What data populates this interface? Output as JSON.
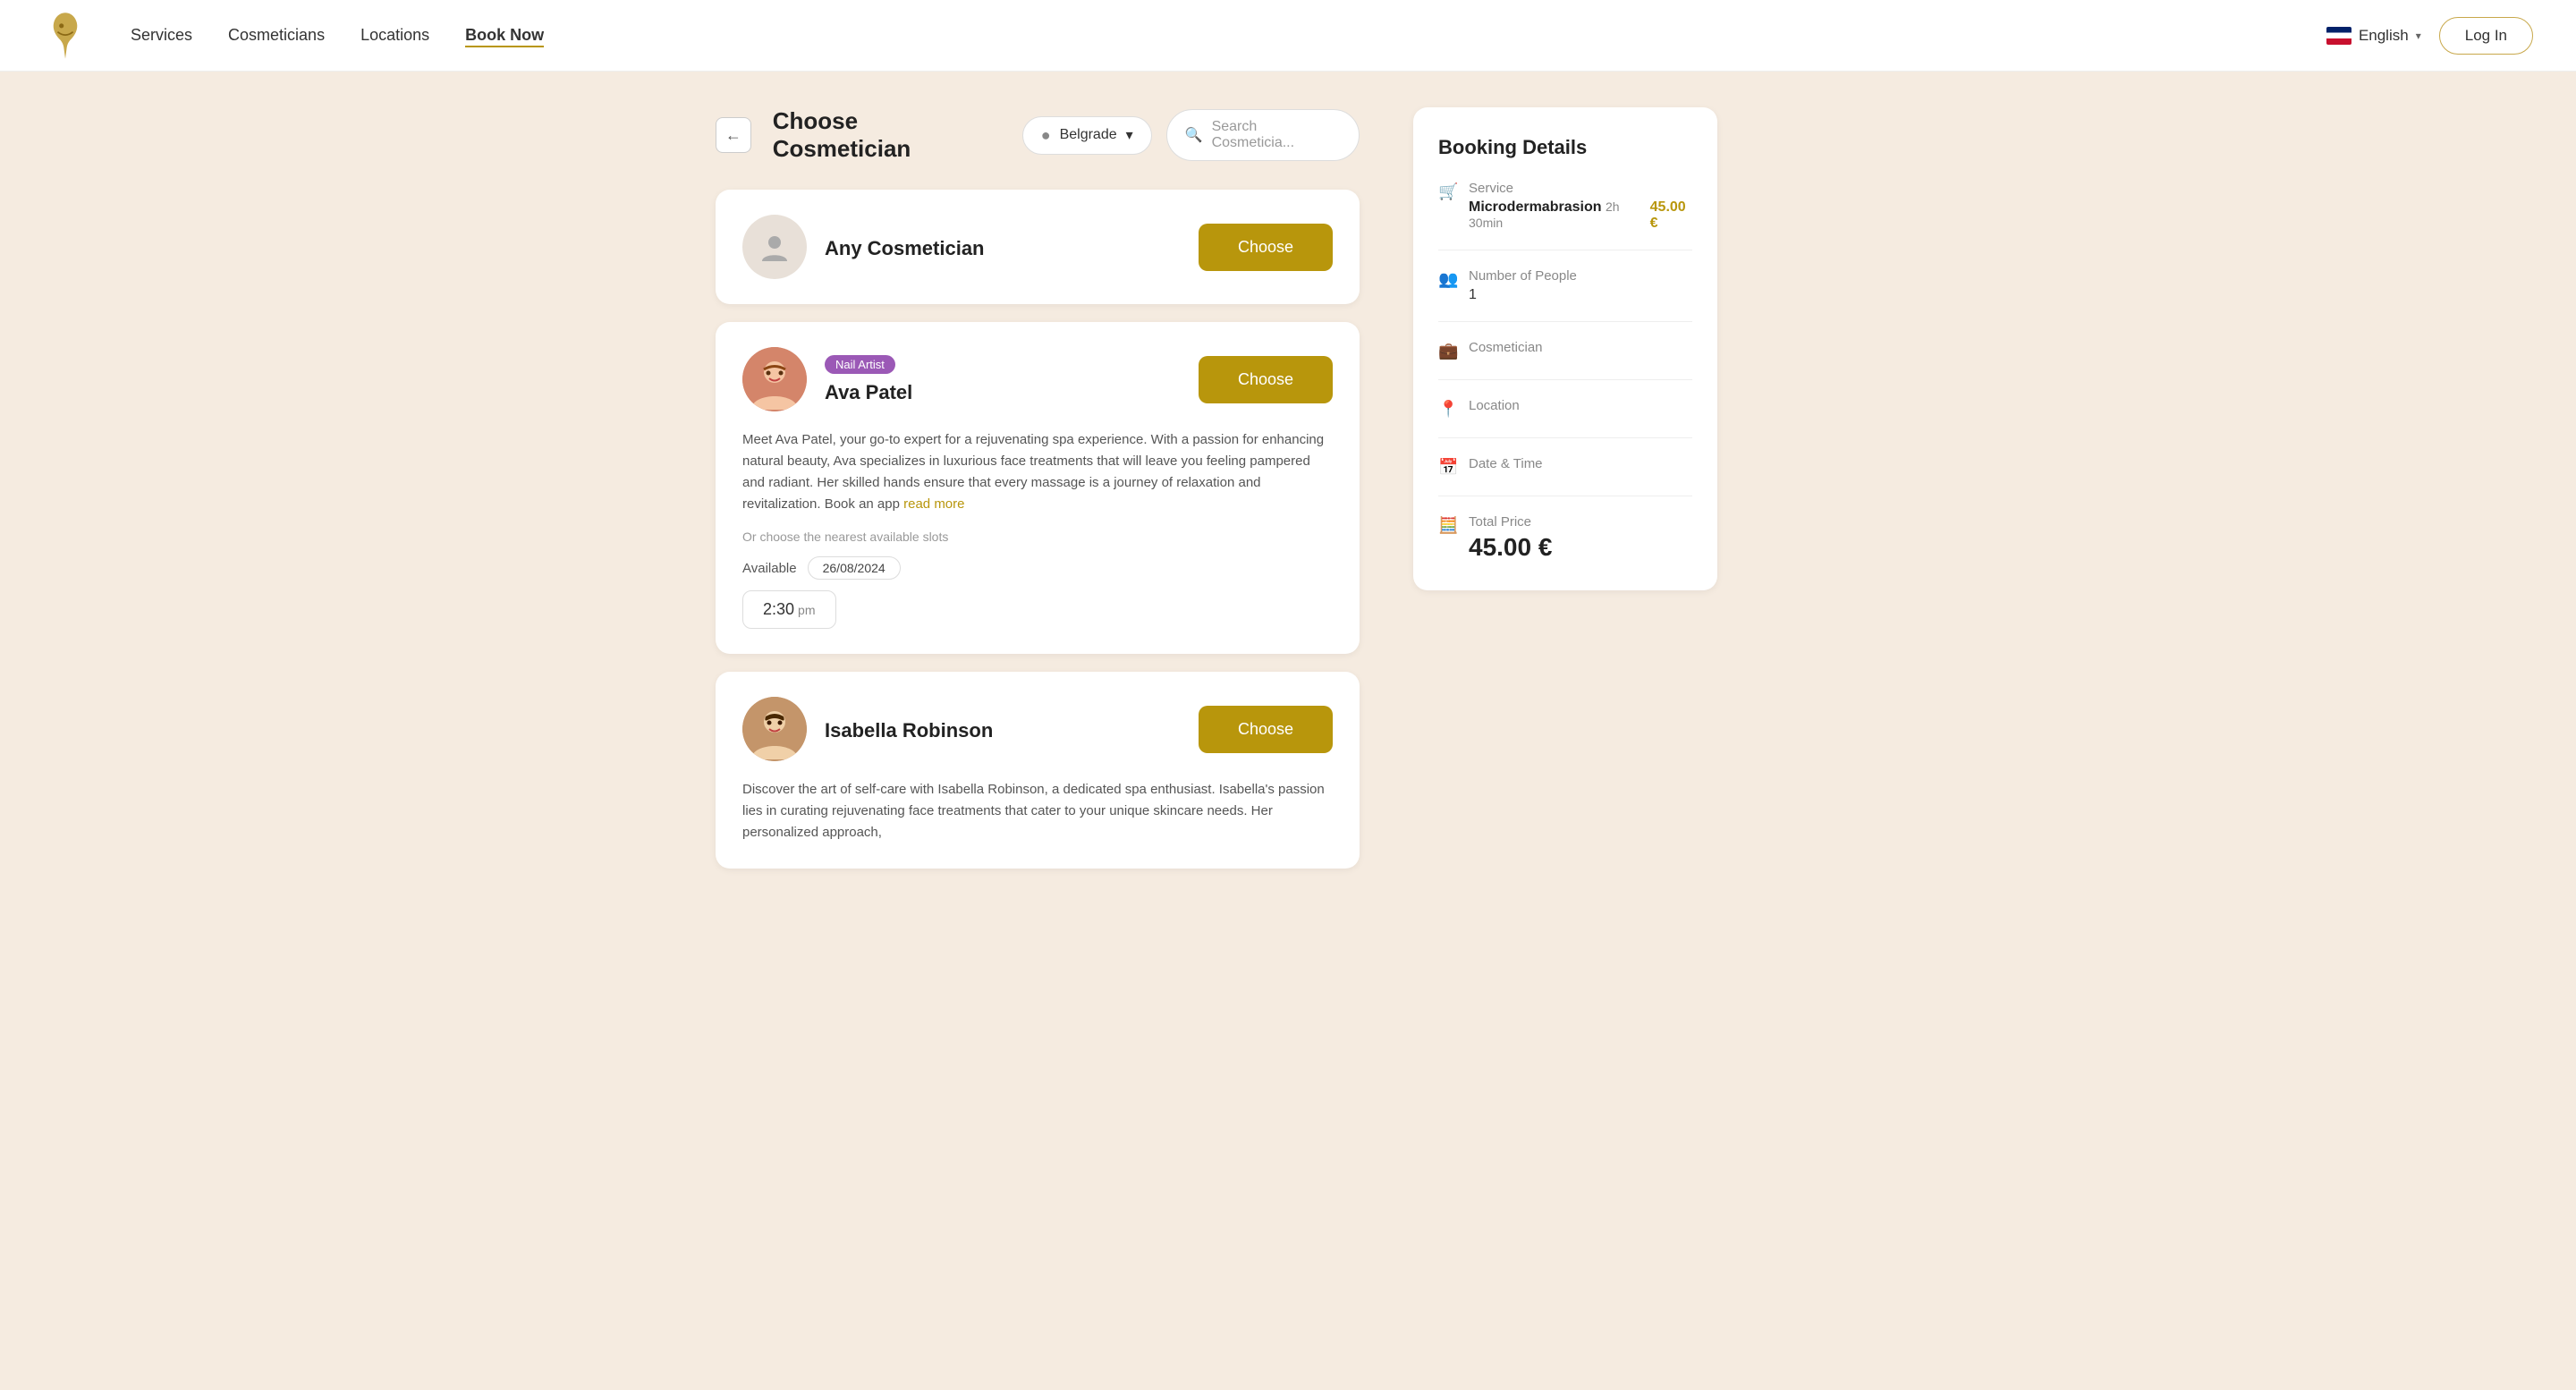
{
  "header": {
    "nav": [
      {
        "label": "Services",
        "active": false
      },
      {
        "label": "Cosmeticians",
        "active": false
      },
      {
        "label": "Locations",
        "active": false
      },
      {
        "label": "Book Now",
        "active": true
      }
    ],
    "language": "English",
    "login_label": "Log In"
  },
  "page": {
    "title": "Choose Cosmetician",
    "location": "Belgrade",
    "search_placeholder": "Search Cosmeticia..."
  },
  "cosmeticians": [
    {
      "id": "any",
      "name": "Any Cosmetician",
      "role": null,
      "avatar_type": "placeholder",
      "description": null,
      "available_date": null,
      "time_slot": null
    },
    {
      "id": "ava",
      "name": "Ava Patel",
      "role": "Nail Artist",
      "avatar_type": "person1",
      "description": "Meet Ava Patel, your go-to expert for a rejuvenating spa experience. With a passion for enhancing natural beauty, Ava specializes in luxurious face treatments that will leave you feeling pampered and radiant. Her skilled hands ensure that every massage is a journey of relaxation and revitalization. Book an app",
      "read_more": "read more",
      "nearest_slots": "Or choose the nearest available slots",
      "available_label": "Available",
      "available_date": "26/08/2024",
      "time_slot": "2:30",
      "time_slot_ampm": "pm"
    },
    {
      "id": "isabella",
      "name": "Isabella Robinson",
      "role": null,
      "avatar_type": "person2",
      "description": "Discover the art of self-care with Isabella Robinson, a dedicated spa enthusiast. Isabella's passion lies in curating rejuvenating face treatments that cater to your unique skincare needs. Her personalized approach,",
      "read_more": null,
      "nearest_slots": null,
      "available_date": null,
      "time_slot": null
    }
  ],
  "choose_button_label": "Choose",
  "booking": {
    "title": "Booking Details",
    "service_label": "Service",
    "service_name": "Microdermabrasion",
    "service_duration": "2h 30min",
    "service_price": "45.00 €",
    "people_label": "Number of People",
    "people_count": "1",
    "cosmetician_label": "Cosmetician",
    "location_label": "Location",
    "datetime_label": "Date & Time",
    "total_label": "Total Price",
    "total_price": "45.00 €"
  }
}
